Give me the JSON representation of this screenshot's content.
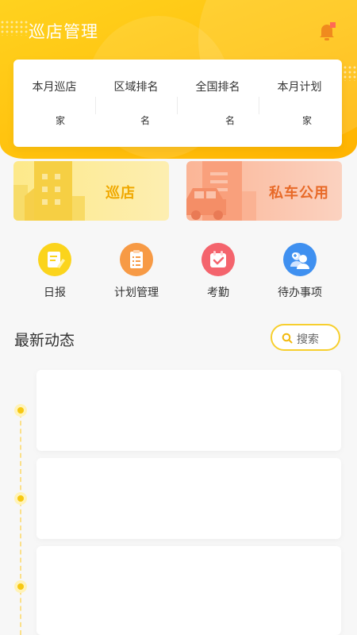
{
  "header": {
    "title": "巡店管理",
    "bell_icon": "bell-icon"
  },
  "stats": [
    {
      "label": "本月巡店",
      "unit": "家"
    },
    {
      "label": "区域排名",
      "unit": "名"
    },
    {
      "label": "全国排名",
      "unit": "名"
    },
    {
      "label": "本月计划",
      "unit": "家"
    }
  ],
  "banners": {
    "patrol": {
      "label": "巡店",
      "icon": "buildings-icon"
    },
    "car": {
      "label": "私车公用",
      "icon": "car-icon"
    }
  },
  "menu": [
    {
      "label": "日报",
      "icon": "daily-report-icon",
      "color": "#fbd41c"
    },
    {
      "label": "计划管理",
      "icon": "clipboard-icon",
      "color": "#f79a45"
    },
    {
      "label": "考勤",
      "icon": "calendar-check-icon",
      "color": "#f4646d"
    },
    {
      "label": "待办事项",
      "icon": "people-icon",
      "color": "#3f90f0"
    }
  ],
  "feed": {
    "title": "最新动态",
    "search_label": "搜索"
  },
  "colors": {
    "brand_yellow": "#ffc20e",
    "accent_orange": "#e86a28",
    "timeline_dot": "#f7c812"
  }
}
